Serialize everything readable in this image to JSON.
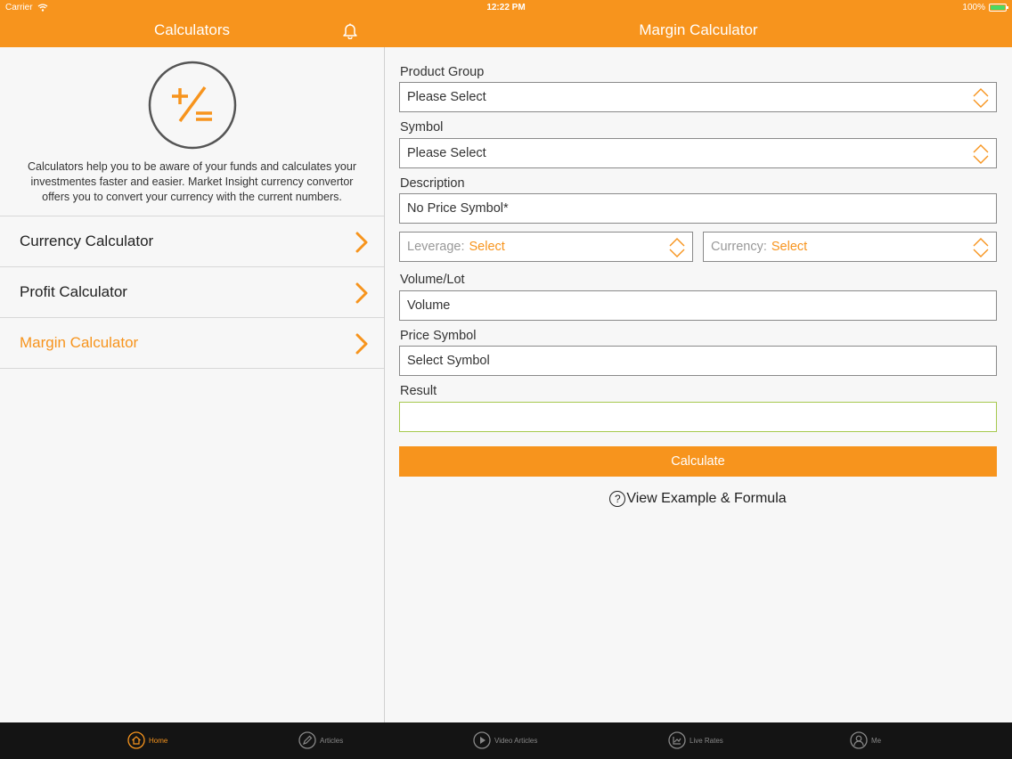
{
  "status_bar": {
    "carrier": "Carrier",
    "time": "12:22 PM",
    "battery": "100%"
  },
  "left": {
    "title": "Calculators",
    "intro": "Calculators help you to be aware of your funds and calculates your investmentes faster and easier. Market Insight currency convertor offers you to convert your currency with the current numbers.",
    "menu": [
      {
        "label": "Currency Calculator"
      },
      {
        "label": "Profit Calculator"
      },
      {
        "label": "Margin Calculator"
      }
    ]
  },
  "right": {
    "title": "Margin Calculator",
    "product_group": {
      "label": "Product Group",
      "value": "Please Select"
    },
    "symbol": {
      "label": "Symbol",
      "value": "Please Select"
    },
    "description": {
      "label": "Description",
      "value": "No Price Symbol*"
    },
    "leverage": {
      "label": "Leverage:",
      "value": "Select"
    },
    "currency": {
      "label": "Currency:",
      "value": "Select"
    },
    "volume": {
      "label": "Volume/Lot",
      "placeholder": "Volume"
    },
    "price_symbol": {
      "label": "Price Symbol",
      "value": "Select Symbol"
    },
    "result": {
      "label": "Result",
      "value": ""
    },
    "calculate_label": "Calculate",
    "example_label": "View Example & Formula"
  },
  "tabs": [
    {
      "label": "Home",
      "icon": "home-icon"
    },
    {
      "label": "Articles",
      "icon": "pencil-icon"
    },
    {
      "label": "Video Articles",
      "icon": "play-icon"
    },
    {
      "label": "Live Rates",
      "icon": "chart-icon"
    },
    {
      "label": "Me",
      "icon": "user-icon"
    }
  ],
  "colors": {
    "accent": "#f7941d",
    "tabbar": "#141414",
    "result_border": "#a6c94e"
  }
}
